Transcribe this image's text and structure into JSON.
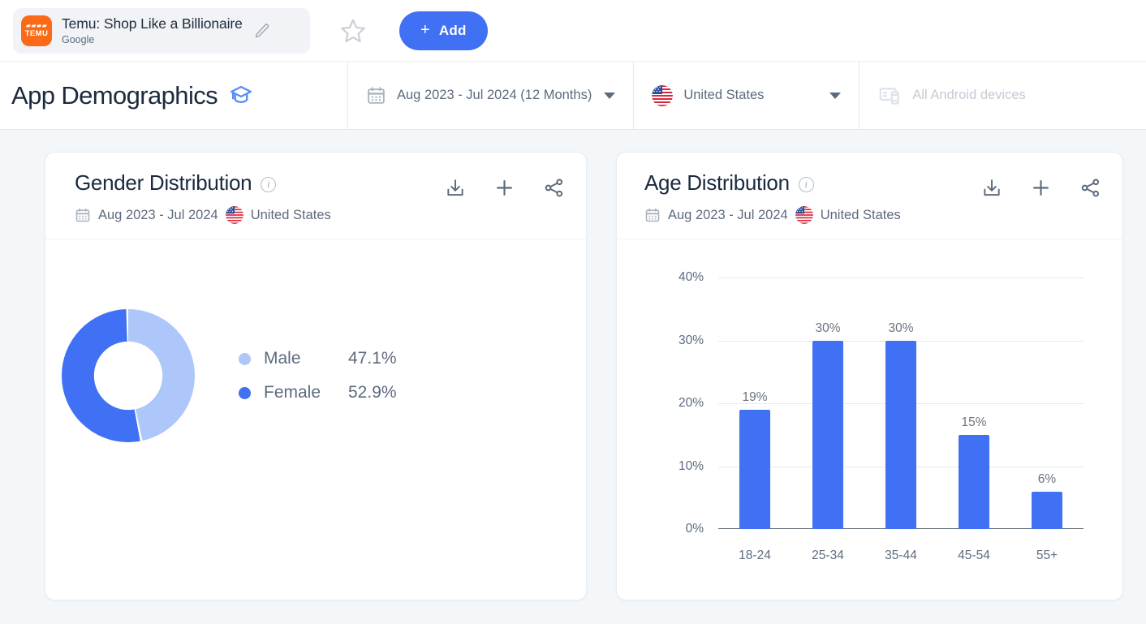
{
  "topbar": {
    "app_logo_glyphs": "▰▰▰▰",
    "app_logo_word": "TEMU",
    "app_name": "Temu: Shop Like a Billionaire",
    "app_developer": "Google",
    "edit_icon": "pencil-icon",
    "star_icon": "star-outline-icon",
    "add_button_plus": "+",
    "add_button_label": "Add"
  },
  "filterbar": {
    "page_title": "App Demographics",
    "academy_icon": "graduation-cap-icon",
    "date_filter": {
      "icon": "calendar-icon",
      "value": "Aug 2023 - Jul 2024 (12 Months)"
    },
    "country_filter": {
      "icon": "us-flag-icon",
      "value": "United States"
    },
    "device_filter": {
      "icon": "devices-icon",
      "value": "All Android devices",
      "disabled": true
    }
  },
  "cards": {
    "gender": {
      "title": "Gender Distribution",
      "info_icon": "info-icon",
      "date_range": "Aug 2023 - Jul 2024",
      "country": "United States",
      "actions": [
        "download-icon",
        "add-to-report-icon",
        "share-icon"
      ]
    },
    "age": {
      "title": "Age Distribution",
      "info_icon": "info-icon",
      "date_range": "Aug 2023 - Jul 2024",
      "country": "United States",
      "actions": [
        "download-icon",
        "add-to-report-icon",
        "share-icon"
      ]
    }
  },
  "colors": {
    "primary_blue": "#4070f4",
    "light_blue": "#aec7fa",
    "page_bg": "#f4f7fa",
    "logo_orange": "#fb6b17"
  },
  "chart_data": [
    {
      "type": "pie",
      "title": "Gender Distribution",
      "subtitle": "Aug 2023 - Jul 2024 · United States",
      "donut": true,
      "legend_position": "right",
      "labels": [
        "Male",
        "Female"
      ],
      "values": [
        47.1,
        52.9
      ],
      "value_labels": [
        "47.1%",
        "52.9%"
      ],
      "colors": [
        "#aec7fa",
        "#4070f4"
      ]
    },
    {
      "type": "bar",
      "title": "Age Distribution",
      "subtitle": "Aug 2023 - Jul 2024 · United States",
      "categories": [
        "18-24",
        "25-34",
        "35-44",
        "45-54",
        "55+"
      ],
      "values": [
        19,
        30,
        30,
        15,
        6
      ],
      "value_labels": [
        "19%",
        "30%",
        "30%",
        "15%",
        "6%"
      ],
      "yticks": [
        0,
        10,
        20,
        30,
        40
      ],
      "ytick_labels": [
        "0%",
        "10%",
        "20%",
        "30%",
        "40%"
      ],
      "ylim": [
        0,
        40
      ],
      "xlabel": "",
      "ylabel": "",
      "grid": true,
      "legend": false,
      "bar_color": "#4070f4"
    }
  ]
}
